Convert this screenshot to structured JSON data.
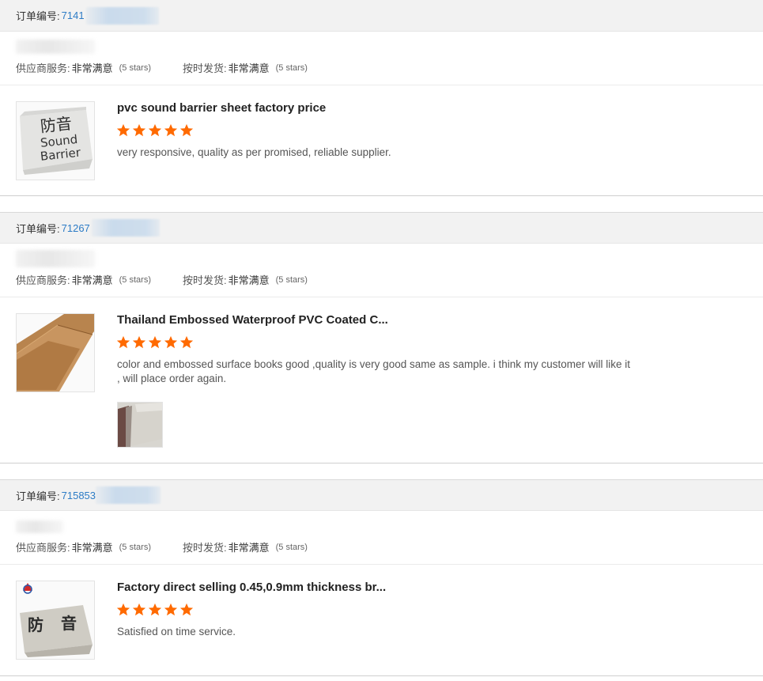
{
  "labels": {
    "order_no_label": "订单编号:",
    "supplier_service_label": "供应商服务:",
    "on_time_label": "按时发货:",
    "satisfied_value": "非常满意",
    "stars_note": "(5 stars)"
  },
  "orders": [
    {
      "order_no": "7141",
      "supplier_service": "非常满意",
      "on_time": "非常满意",
      "product_title": "pvc sound barrier sheet factory price",
      "rating": 5,
      "review_text": "very responsive, quality as per promised, reliable supplier.",
      "thumb_icon": "sound-barrier-sheet-photo",
      "thumb_text": [
        "防音",
        "Sound",
        "Barrier"
      ]
    },
    {
      "order_no": "71267",
      "supplier_service": "非常满意",
      "on_time": "非常满意",
      "product_title": "Thailand Embossed Waterproof PVC Coated C...",
      "rating": 5,
      "review_text": "color and embossed surface books good ,quality is very good same as sample. i think my customer will like it , will place order again.",
      "thumb_icon": "brown-pvc-roll-photo",
      "review_photo_icon": "fabric-sample-photo"
    },
    {
      "order_no": "715853",
      "supplier_service": "非常满意",
      "on_time": "非常满意",
      "product_title": "Factory direct selling 0.45,0.9mm thickness br...",
      "rating": 5,
      "review_text": "Satisfied on time service.",
      "thumb_icon": "sound-barrier-sheet-logo-photo",
      "thumb_text": [
        "防",
        "音"
      ]
    }
  ],
  "colors": {
    "star": "#ff6a00",
    "link": "#2d7cc6",
    "header_bg": "#f2f2f2"
  }
}
